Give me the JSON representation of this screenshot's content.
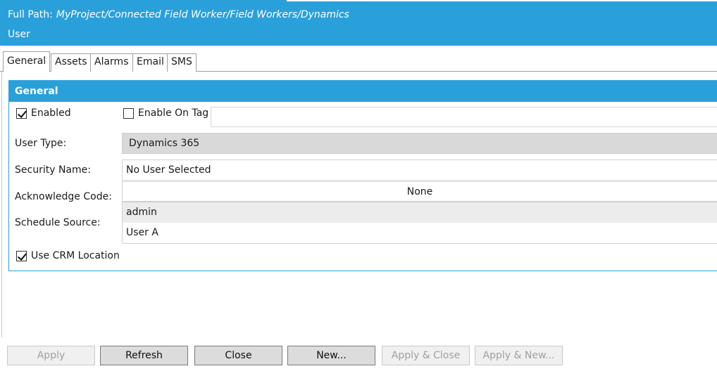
{
  "header": {
    "full_path_label": "Full Path:",
    "full_path_value": "MyProject/Connected Field Worker/Field Workers/Dynamics",
    "subtitle": "User",
    "color": "#2aa0db"
  },
  "tabs": [
    {
      "label": "General",
      "active": true
    },
    {
      "label": "Assets",
      "active": false
    },
    {
      "label": "Alarms",
      "active": false
    },
    {
      "label": "Email",
      "active": false
    },
    {
      "label": "SMS",
      "active": false
    }
  ],
  "panel": {
    "title": "General",
    "enabled": {
      "label": "Enabled",
      "checked": true
    },
    "enable_on_tag": {
      "label": "Enable On Tag",
      "checked": false,
      "value": ""
    },
    "user_type": {
      "label": "User Type:",
      "value": "Dynamics 365"
    },
    "security_name": {
      "label": "Security Name:",
      "value": "No User Selected"
    },
    "acknowledge_code": {
      "label": "Acknowledge Code:",
      "value": "None"
    },
    "schedule_source": {
      "label": "Schedule Source:",
      "options": [
        "admin",
        "User A"
      ],
      "selected": "admin"
    },
    "use_crm_location": {
      "label": "Use CRM Location",
      "checked": true
    }
  },
  "buttons": [
    {
      "label": "Apply",
      "enabled": false
    },
    {
      "label": "Refresh",
      "enabled": true
    },
    {
      "label": "Close",
      "enabled": true
    },
    {
      "label": "New...",
      "enabled": true
    },
    {
      "label": "Apply & Close",
      "enabled": false
    },
    {
      "label": "Apply & New...",
      "enabled": false
    }
  ]
}
